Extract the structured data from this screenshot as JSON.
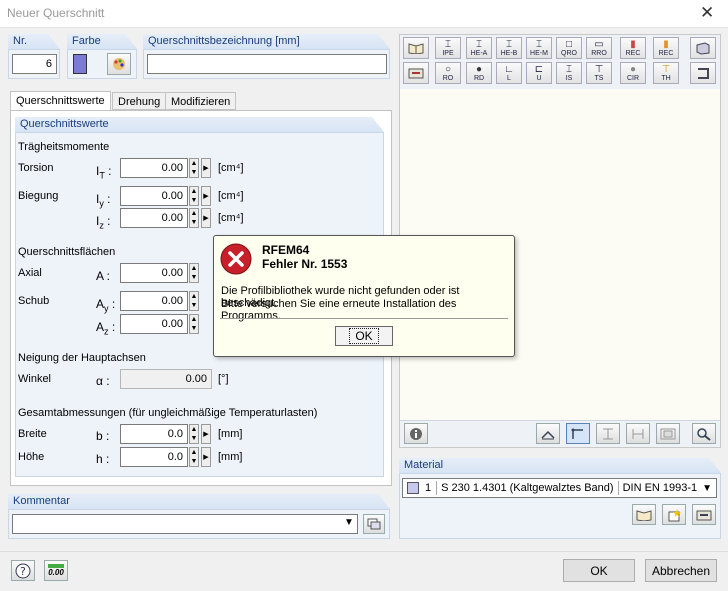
{
  "window": {
    "title": "Neuer Querschnitt",
    "close_glyph": "✕"
  },
  "nr": {
    "label": "Nr.",
    "value": "6"
  },
  "farbe": {
    "label": "Farbe",
    "color": "#7b7bd6"
  },
  "bezeichnung": {
    "label": "Querschnittsbezeichnung [mm]",
    "value": ""
  },
  "tabs": [
    {
      "label": "Querschnittswerte"
    },
    {
      "label": "Drehung"
    },
    {
      "label": "Modifizieren"
    }
  ],
  "values_panel": {
    "header": "Querschnittswerte",
    "traegheit": {
      "title": "Trägheitsmomente",
      "rows": [
        {
          "label": "Torsion",
          "sym": "I",
          "sub": "T",
          "value": "0.00",
          "unit": "[cm⁴]"
        },
        {
          "label": "Biegung",
          "sym": "I",
          "sub": "y",
          "value": "0.00",
          "unit": "[cm⁴]"
        },
        {
          "label": "",
          "sym": "I",
          "sub": "z",
          "value": "0.00",
          "unit": "[cm⁴]"
        }
      ]
    },
    "flaechen": {
      "title": "Querschnittsflächen",
      "rows": [
        {
          "label": "Axial",
          "sym": "A",
          "sub": "",
          "value": "0.00"
        },
        {
          "label": "Schub",
          "sym": "A",
          "sub": "y",
          "value": "0.00"
        },
        {
          "label": "",
          "sym": "A",
          "sub": "z",
          "value": "0.00"
        }
      ]
    },
    "neigung": {
      "title": "Neigung der Hauptachsen",
      "row": {
        "label": "Winkel",
        "sym": "α",
        "value": "0.00",
        "unit": "[°]"
      }
    },
    "gesamt": {
      "title": "Gesamtabmessungen (für ungleichmäßige Temperaturlasten)",
      "rows": [
        {
          "label": "Breite",
          "sym": "b",
          "value": "0.0",
          "unit": "[mm]"
        },
        {
          "label": "Höhe",
          "sym": "h",
          "value": "0.0",
          "unit": "[mm]"
        }
      ]
    }
  },
  "kommentar": {
    "label": "Kommentar",
    "value": ""
  },
  "toolbar_row1": [
    "",
    "IPE",
    "HE-A",
    "HE-B",
    "HE-M",
    "QRO",
    "RRO",
    "REC",
    "REC",
    ""
  ],
  "toolbar_row2": [
    "",
    "RO",
    "RD",
    "L",
    "U",
    "IS",
    "TS",
    "CIR",
    "TH",
    ""
  ],
  "material": {
    "label": "Material",
    "number": "1",
    "name": "S 230 1.4301 (Kaltgewalztes Band)",
    "norm": "DIN EN 1993-1",
    "swatch": "#c8c8ec"
  },
  "buttons": {
    "ok": "OK",
    "cancel": "Abbrechen",
    "calc_label": "0.00"
  },
  "message": {
    "title": "RFEM64",
    "subtitle": "Fehler Nr. 1553",
    "line1": "Die Profilbibliothek wurde nicht gefunden oder ist beschädigt.",
    "line2": "Bitte versuchen Sie eine erneute Installation des Programms.",
    "ok": "OK"
  }
}
